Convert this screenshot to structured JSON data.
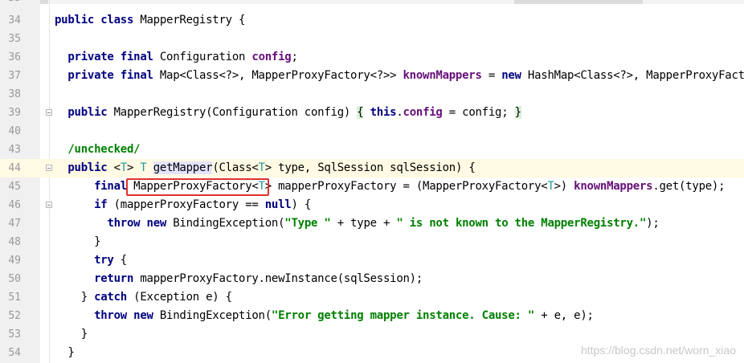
{
  "editor": {
    "lines": [
      {
        "num": "34",
        "segments": [
          [
            "kw",
            "public class "
          ],
          [
            "ty",
            "MapperRegistry {"
          ]
        ]
      },
      {
        "num": "35",
        "segments": []
      },
      {
        "num": "36",
        "segments": [
          [
            "ty",
            "  "
          ],
          [
            "kw",
            "private final "
          ],
          [
            "ty",
            "Configuration "
          ],
          [
            "fld",
            "config"
          ],
          [
            "ty",
            ";"
          ]
        ]
      },
      {
        "num": "37",
        "segments": [
          [
            "ty",
            "  "
          ],
          [
            "kw",
            "private final "
          ],
          [
            "ty",
            "Map<Class<?>, MapperProxyFactory<?>> "
          ],
          [
            "fld",
            "knownMappers"
          ],
          [
            "ty",
            " = "
          ],
          [
            "kw",
            "new "
          ],
          [
            "ty",
            "HashMap<Class<?>, MapperProxyFactory"
          ]
        ]
      },
      {
        "num": "38",
        "segments": []
      },
      {
        "num": "39",
        "segments": [
          [
            "ty",
            "  "
          ],
          [
            "kw",
            "public "
          ],
          [
            "ty",
            "MapperRegistry(Configuration config) "
          ],
          [
            "brk",
            "{"
          ],
          [
            "ty",
            " "
          ],
          [
            "kw",
            "this"
          ],
          [
            "ty",
            "."
          ],
          [
            "fld",
            "config"
          ],
          [
            "ty",
            " = config; "
          ],
          [
            "brk",
            "}"
          ]
        ]
      },
      {
        "num": "40",
        "segments": []
      },
      {
        "num": "43",
        "segments": [
          [
            "ty",
            "  "
          ],
          [
            "ann",
            "/unchecked/"
          ]
        ]
      },
      {
        "num": "44",
        "segments": [
          [
            "ty",
            "  "
          ],
          [
            "kw",
            "public "
          ],
          [
            "ty",
            "<"
          ],
          [
            "tp",
            "T"
          ],
          [
            "ty",
            "> "
          ],
          [
            "tp",
            "T "
          ],
          [
            "hlmeth",
            "getMapper"
          ],
          [
            "ty",
            "(Class<"
          ],
          [
            "tp",
            "T"
          ],
          [
            "ty",
            "> type, SqlSession sqlSession) {"
          ]
        ]
      },
      {
        "num": "45",
        "segments": [
          [
            "ty",
            "      "
          ],
          [
            "kw",
            "final "
          ],
          [
            "ty",
            "MapperProxyFactory<"
          ],
          [
            "tp",
            "T"
          ],
          [
            "ty",
            "> mapperProxyFactory = (MapperProxyFactory<"
          ],
          [
            "tp",
            "T"
          ],
          [
            "ty",
            ">) "
          ],
          [
            "fld",
            "knownMappers"
          ],
          [
            "ty",
            ".get(type);"
          ]
        ]
      },
      {
        "num": "46",
        "segments": [
          [
            "ty",
            "      "
          ],
          [
            "kw",
            "if "
          ],
          [
            "ty",
            "(mapperProxyFactory == "
          ],
          [
            "kw",
            "null"
          ],
          [
            "ty",
            ") {"
          ]
        ]
      },
      {
        "num": "47",
        "segments": [
          [
            "ty",
            "        "
          ],
          [
            "kw",
            "throw new "
          ],
          [
            "ty",
            "BindingException("
          ],
          [
            "str",
            "\"Type \""
          ],
          [
            "ty",
            " + type + "
          ],
          [
            "str",
            "\" is not known to the MapperRegistry.\""
          ],
          [
            "ty",
            ");"
          ]
        ]
      },
      {
        "num": "48",
        "segments": [
          [
            "ty",
            "      }"
          ]
        ]
      },
      {
        "num": "49",
        "segments": [
          [
            "ty",
            "      "
          ],
          [
            "kw",
            "try "
          ],
          [
            "ty",
            "{"
          ]
        ]
      },
      {
        "num": "50",
        "segments": [
          [
            "ty",
            "      "
          ],
          [
            "kw",
            "return "
          ],
          [
            "ty",
            "mapperProxyFactory.newInstance(sqlSession);"
          ]
        ]
      },
      {
        "num": "51",
        "segments": [
          [
            "ty",
            "    } "
          ],
          [
            "kw",
            "catch "
          ],
          [
            "ty",
            "(Exception e) {"
          ]
        ]
      },
      {
        "num": "52",
        "segments": [
          [
            "ty",
            "      "
          ],
          [
            "kw",
            "throw new "
          ],
          [
            "ty",
            "BindingException("
          ],
          [
            "str",
            "\"Error getting mapper instance. Cause: \""
          ],
          [
            "ty",
            " + e, e);"
          ]
        ]
      },
      {
        "num": "53",
        "segments": [
          [
            "ty",
            "    }"
          ]
        ]
      },
      {
        "num": "54",
        "segments": [
          [
            "ty",
            "  }"
          ]
        ]
      }
    ],
    "highlight_line": "44",
    "top_partial_num": "33"
  },
  "watermark": "https://blog.csdn.net/worn_xiao",
  "colors": {
    "keyword": "#000080",
    "field": "#660e7a",
    "string": "#008000",
    "type_param": "#20999d",
    "annotation_box": "#e0312c"
  }
}
